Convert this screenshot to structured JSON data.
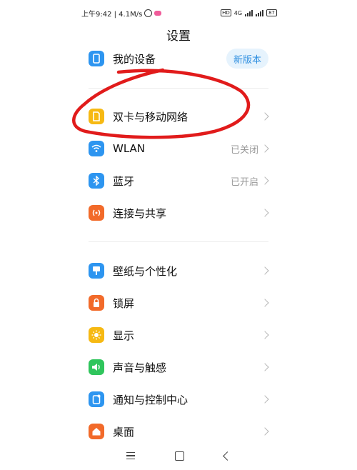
{
  "statusbar": {
    "time_speed": "上午9:42 | 4.1M/s",
    "network": "4G",
    "battery": "87"
  },
  "title": "设置",
  "items": [
    {
      "label": "我的设备",
      "badge": "新版本",
      "icon": "device-icon",
      "color": "#2d95f0"
    },
    {
      "label": "双卡与移动网络",
      "icon": "sim-card-icon",
      "color": "#f6b913"
    },
    {
      "label": "WLAN",
      "status": "已关闭",
      "icon": "wifi-icon",
      "color": "#2d95f0"
    },
    {
      "label": "蓝牙",
      "status": "已开启",
      "icon": "bluetooth-icon",
      "color": "#2d95f0"
    },
    {
      "label": "连接与共享",
      "icon": "share-icon",
      "color": "#f26a2a"
    },
    {
      "label": "壁纸与个性化",
      "icon": "wallpaper-icon",
      "color": "#2d95f0"
    },
    {
      "label": "锁屏",
      "icon": "lock-icon",
      "color": "#f26a2a"
    },
    {
      "label": "显示",
      "icon": "sun-icon",
      "color": "#f6b913"
    },
    {
      "label": "声音与触感",
      "icon": "speaker-icon",
      "color": "#2fc55c"
    },
    {
      "label": "通知与控制中心",
      "icon": "notification-icon",
      "color": "#2d95f0"
    },
    {
      "label": "桌面",
      "icon": "home-icon",
      "color": "#f26a2a"
    }
  ],
  "annotation_color": "#e11b1b"
}
